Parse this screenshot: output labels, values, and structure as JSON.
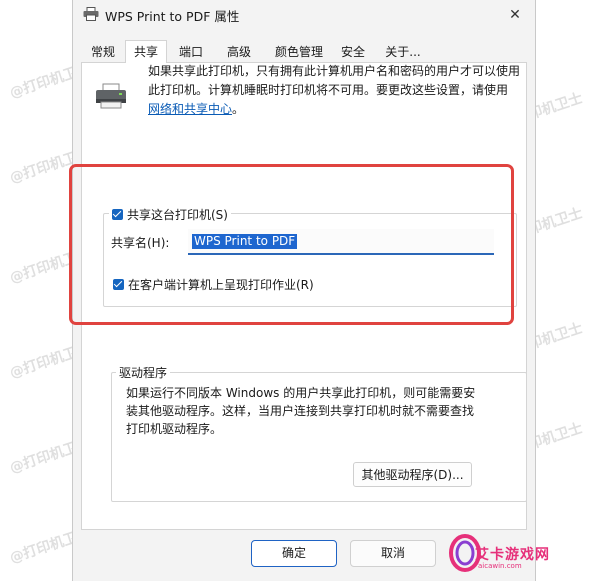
{
  "dialog": {
    "title": "WPS Print to PDF 属性",
    "close_glyph": "✕"
  },
  "tabs": [
    {
      "label": "常规"
    },
    {
      "label": "共享"
    },
    {
      "label": "端口"
    },
    {
      "label": "高级"
    },
    {
      "label": "颜色管理"
    },
    {
      "label": "安全"
    },
    {
      "label": "关于..."
    }
  ],
  "active_tab": "共享",
  "share": {
    "description": "如果共享此打印机，只有拥有此计算机用户名和密码的用户才可以使用此打印机。计算机睡眠时打印机将不可用。要更改这些设置，请使用",
    "link_text": "网络和共享中心",
    "link_suffix": "。",
    "share_checkbox_label": "共享这台打印机(S)",
    "share_checked": true,
    "share_name_label": "共享名(H):",
    "share_name_value": "WPS Print to PDF",
    "render_checkbox_label": "在客户端计算机上呈现打印作业(R)",
    "render_checked": true
  },
  "drivers": {
    "legend": "驱动程序",
    "text": "如果运行不同版本 Windows 的用户共享此打印机，则可能需要安装其他驱动程序。这样，当用户连接到共享打印机时就不需要查找打印机驱动程序。",
    "button": "其他驱动程序(D)..."
  },
  "buttons": {
    "ok": "确定",
    "cancel": "取消"
  },
  "watermark": "@打印机卫士",
  "logo": {
    "text": "艾卡游戏网",
    "sub": "aicawin.com"
  },
  "colors": {
    "highlight_box": "#e0433f",
    "accent": "#1565c0",
    "logo": "#e6307a"
  }
}
